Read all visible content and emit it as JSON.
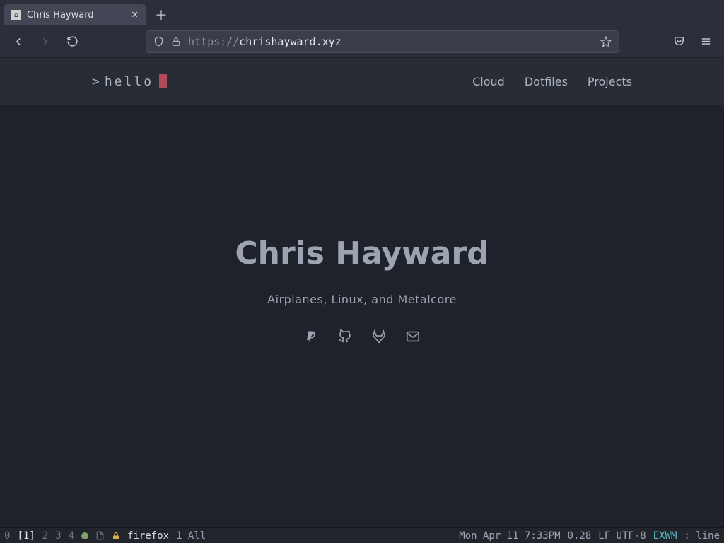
{
  "browser": {
    "tab_title": "Chris Hayward",
    "url_proto": "https://",
    "url_host": "chrishayward.xyz",
    "url_path": ""
  },
  "site": {
    "logo_prefix": ">",
    "logo_text": "hello",
    "nav": [
      "Cloud",
      "Dotfiles",
      "Projects"
    ],
    "hero_name": "Chris Hayward",
    "hero_tagline": "Airplanes, Linux, and Metalcore",
    "social": [
      "paypal",
      "github",
      "gitlab",
      "email"
    ]
  },
  "modeline": {
    "workspaces": [
      "0",
      "1",
      "2",
      "3",
      "4"
    ],
    "active_workspace": "1",
    "buffer": "firefox",
    "position": "1 All",
    "datetime": "Mon Apr 11 7:33PM",
    "load": "0.28",
    "encoding": "LF UTF-8",
    "mode": "EXWM",
    "line_indicator": ": line"
  }
}
